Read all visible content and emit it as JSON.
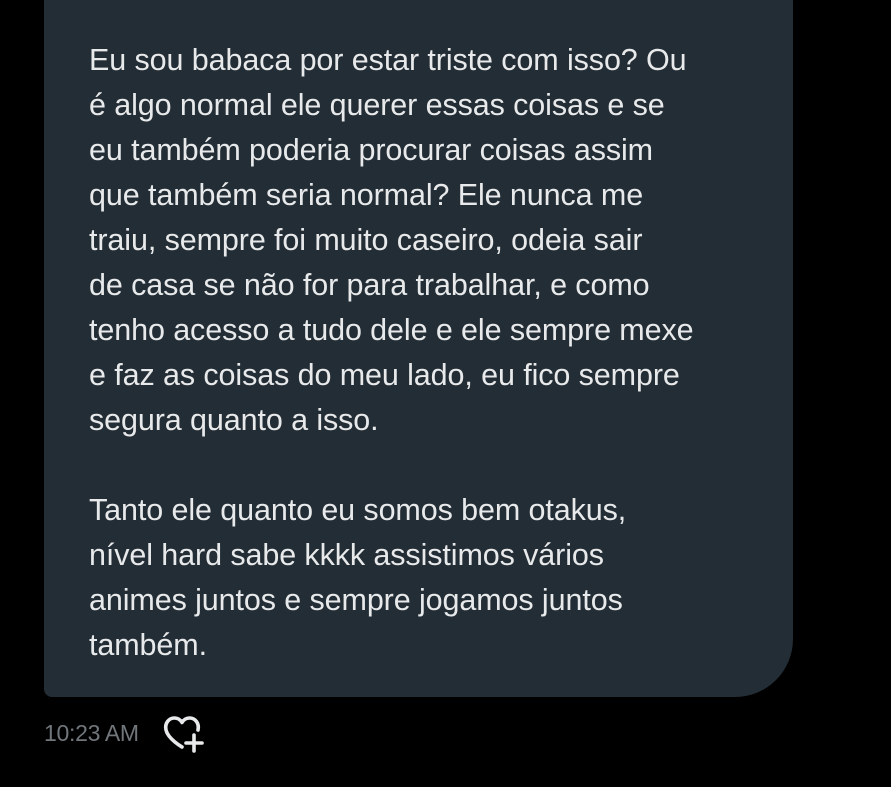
{
  "message": {
    "paragraphs": [
      {
        "lines": [
          "Eu sou babaca por estar triste com isso? Ou",
          "é algo normal ele querer essas coisas e se",
          "eu também poderia procurar coisas assim",
          "que também seria normal? Ele nunca me",
          "traiu, sempre foi muito caseiro, odeia sair",
          "de casa se não for para trabalhar, e como",
          "tenho acesso a tudo dele e ele sempre mexe",
          "e faz as coisas do meu lado, eu fico sempre",
          "segura quanto a isso."
        ]
      },
      {
        "lines": [
          "Tanto ele quanto eu somos bem otakus,",
          "nível hard sabe kkkk assistimos vários",
          "animes juntos e sempre jogamos juntos",
          "também."
        ]
      }
    ],
    "timestamp": "10:23 AM",
    "react_icon": "heart-plus-icon"
  },
  "colors": {
    "background": "#000000",
    "bubble": "#232d35",
    "text": "#e7e9ea",
    "muted": "#71767b"
  }
}
